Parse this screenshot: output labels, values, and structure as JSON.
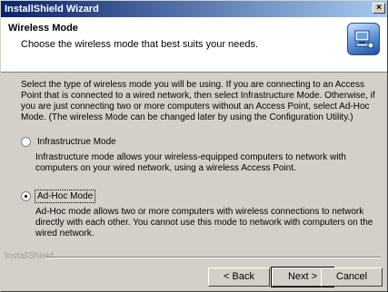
{
  "window": {
    "title": "InstallShield Wizard",
    "close_glyph": "×"
  },
  "header": {
    "title": "Wireless Mode",
    "subtitle": "Choose the wireless mode that best suits your needs.",
    "icon": "network-computer-icon"
  },
  "intro": "Select the type of wireless mode you will be using. If you are connecting to an Access Point that is connected to a wired network, then select Infrastructure Mode. Otherwise, if you are just connecting two or more computers without an Access Point, select Ad-Hoc Mode. (The wireless Mode can be changed later by using the Configuration Utility.)",
  "options": [
    {
      "label": "Infrastructrue Mode",
      "description": "Infrastructure mode allows your wireless-equipped computers to network with computers on your wired network, using a wireless Access Point.",
      "selected": false
    },
    {
      "label": "Ad-Hoc Mode",
      "description": "Ad-Hoc mode allows two or more computers with wireless connections to network directly with each other. You cannot use this mode to network with computers on the wired network.",
      "selected": true
    }
  ],
  "footer": {
    "brand": "InstallShield",
    "back_label": "< Back",
    "next_label": "Next >",
    "cancel_label": "Cancel"
  }
}
